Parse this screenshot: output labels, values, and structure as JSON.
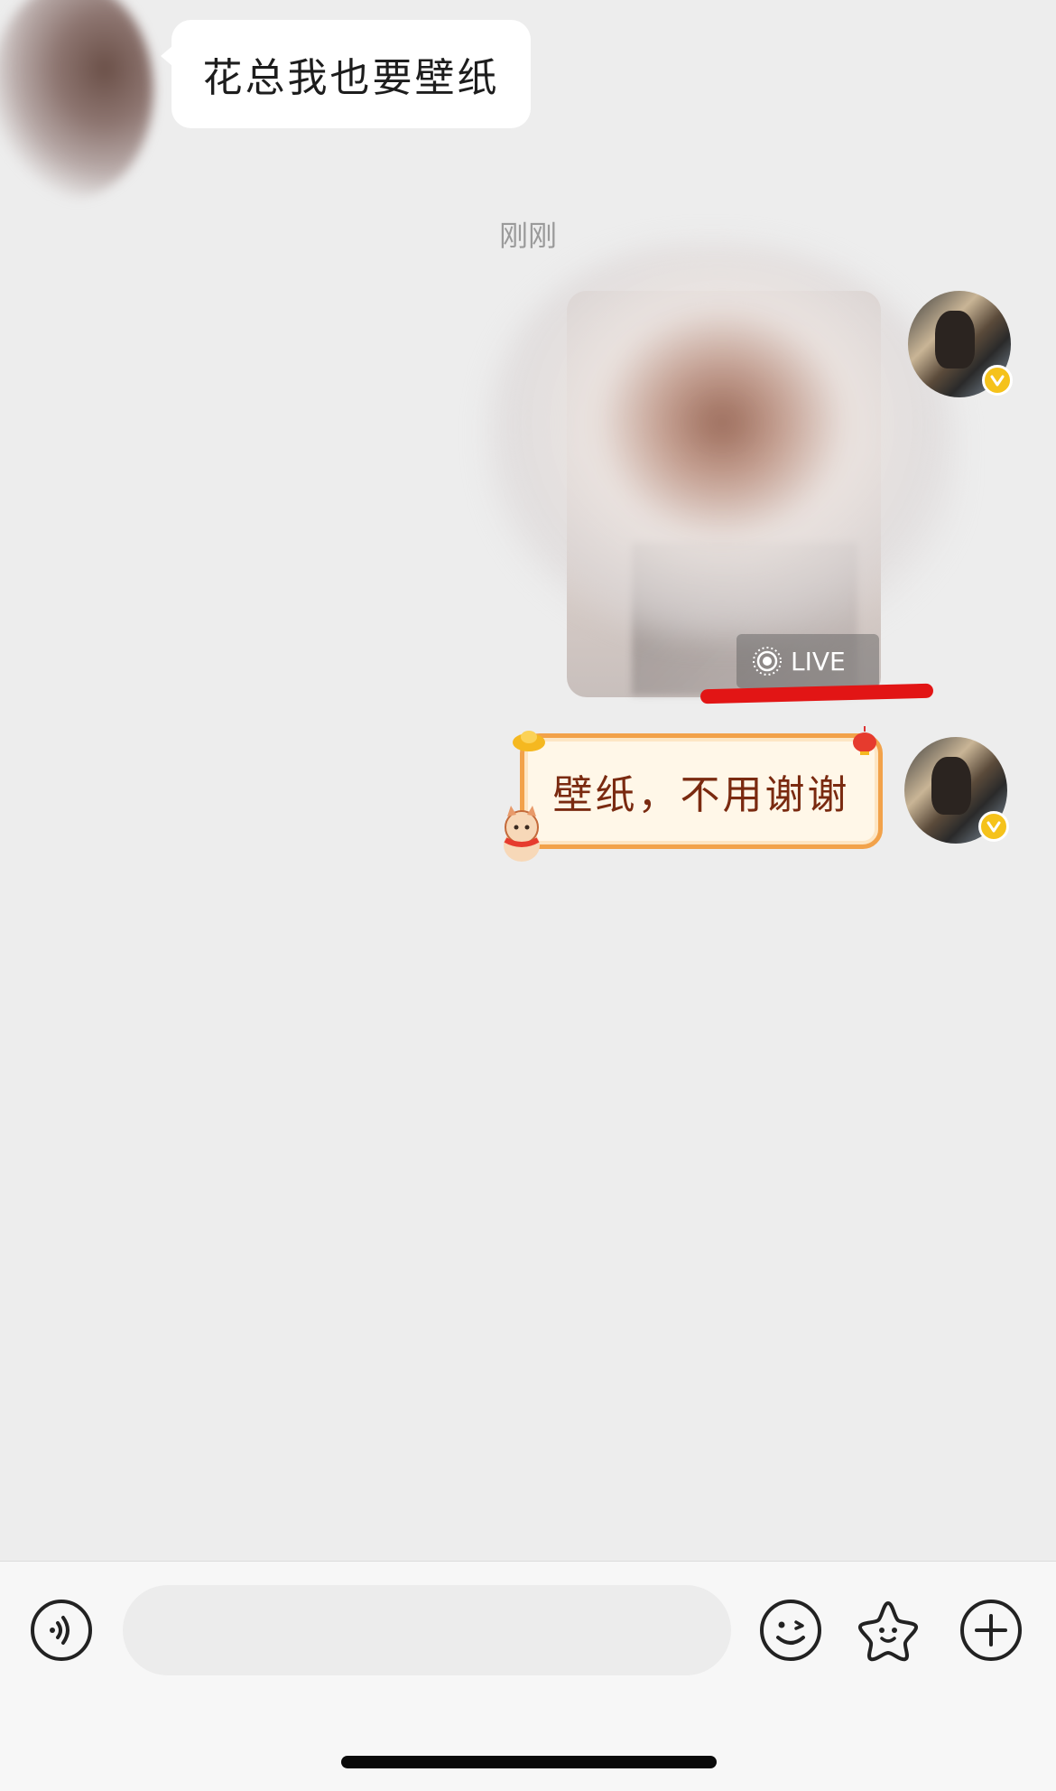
{
  "messages": {
    "incoming": {
      "text": "花总我也要壁纸"
    },
    "timestamp": "刚刚",
    "photo": {
      "badge": "LIVE",
      "annotation_color": "#e21515"
    },
    "outgoing_text": {
      "text": "壁纸，不用谢谢"
    }
  },
  "input_bar": {
    "placeholder": "",
    "voice_icon": "voice-icon",
    "emoji_icon": "emoji-icon",
    "sticker_icon": "sticker-icon",
    "plus_icon": "plus-icon"
  },
  "colors": {
    "chat_background": "#ededed",
    "verified_badge": "#f5c21b",
    "bubble_text_red": "#7a2a10"
  }
}
